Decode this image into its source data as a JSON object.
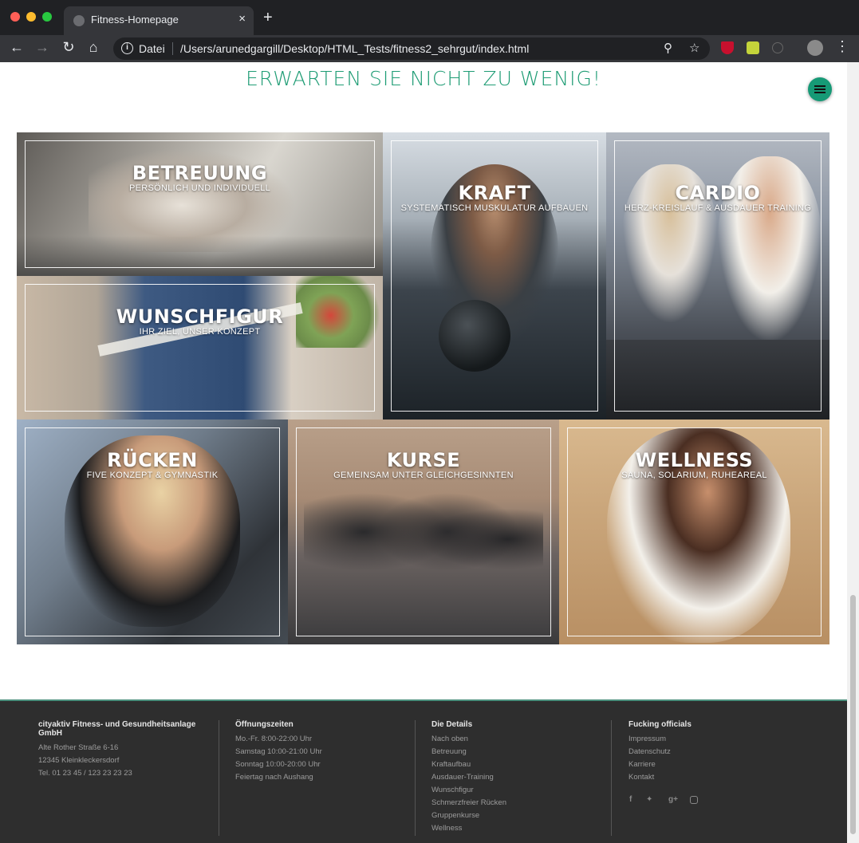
{
  "browser": {
    "tab_title": "Fitness-Homepage",
    "tab_close": "×",
    "new_tab": "+",
    "scheme_label": "Datei",
    "url": "/Users/arunedgargill/Desktop/HTML_Tests/fitness2_sehrgut/index.html",
    "icons": [
      "back-icon",
      "forward-icon",
      "reload-icon",
      "home-icon",
      "info-icon",
      "zoom-icon",
      "star-icon",
      "menu-icon"
    ]
  },
  "page": {
    "headline": "ERWARTEN SIE NICHT ZU WENIG!",
    "accent_color": "#1e9c74",
    "tiles": [
      {
        "title": "BETREUUNG",
        "subtitle": "PERSÖNLICH UND INDIVIDUELL"
      },
      {
        "title": "WUNSCHFIGUR",
        "subtitle": "IHR ZIEL, UNSER KONZEPT"
      },
      {
        "title": "KRAFT",
        "subtitle": "SYSTEMATISCH MUSKULATUR AUFBAUEN"
      },
      {
        "title": "CARDIO",
        "subtitle": "HERZ-KREISLAUF & AUSDAUER TRAINING"
      },
      {
        "title": "RÜCKEN",
        "subtitle": "FIVE KONZEPT & GYMNASTIK"
      },
      {
        "title": "KURSE",
        "subtitle": "GEMEINSAM UNTER GLEICHGESINNTEN"
      },
      {
        "title": "WELLNESS",
        "subtitle": "SAUNA, SOLARIUM, RUHEAREAL"
      }
    ]
  },
  "footer": {
    "company": {
      "name": "cityaktiv Fitness- und Gesundheitsanlage GmbH",
      "lines": [
        "Alte Rother Straße 6-16",
        "12345 Kleinkleckersdorf",
        "Tel. 01 23 45 / 123 23 23 23"
      ]
    },
    "hours": {
      "heading": "Öffnungszeiten",
      "lines": [
        "Mo.-Fr. 8:00-22:00 Uhr",
        "Samstag 10:00-21:00 Uhr",
        "Sonntag 10:00-20:00 Uhr",
        "Feiertag nach Aushang"
      ]
    },
    "details": {
      "heading": "Die Details",
      "links": [
        "Nach oben",
        "Betreuung",
        "Kraftaufbau",
        "Ausdauer-Training",
        "Wunschfigur",
        "Schmerzfreier Rücken",
        "Gruppenkurse",
        "Wellness"
      ]
    },
    "officials": {
      "heading": "Fucking officials",
      "links": [
        "Impressum",
        "Datenschutz",
        "Karriere",
        "Kontakt"
      ],
      "social": [
        "f",
        "t",
        "g+",
        "ig"
      ]
    }
  }
}
